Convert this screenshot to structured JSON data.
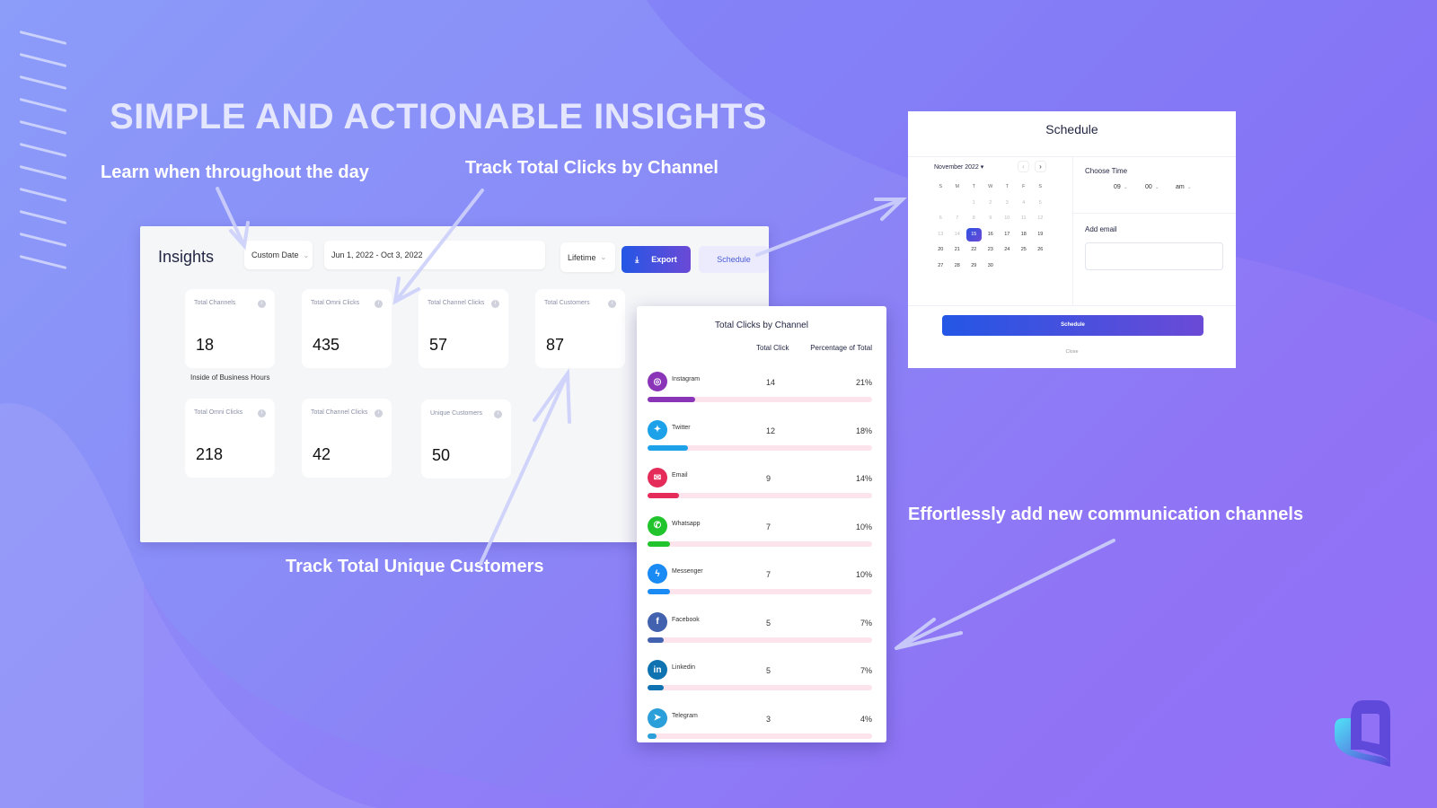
{
  "headline": "SIMPLE AND ACTIONABLE INSIGHTS",
  "captions": {
    "learn": "Learn when throughout the day",
    "clicks": "Track Total Clicks by Channel",
    "customers": "Track Total Unique Customers",
    "channels": "Effortlessly add new communication channels"
  },
  "insights": {
    "title": "Insights",
    "date_mode": "Custom Date",
    "date_range": "Jun 1, 2022 - Oct 3, 2022",
    "period": "Lifetime",
    "export_label": "Export",
    "schedule_label": "Schedule",
    "overview_cards": [
      {
        "label": "Total Channels",
        "value": "18"
      },
      {
        "label": "Total Omni Clicks",
        "value": "435"
      },
      {
        "label": "Total Channel Clicks",
        "value": "57"
      },
      {
        "label": "Total Customers",
        "value": "87"
      }
    ],
    "business_hours_label": "Inside of Business Hours",
    "business_cards": [
      {
        "label": "Total Omni Clicks",
        "value": "218"
      },
      {
        "label": "Total Channel Clicks",
        "value": "42"
      },
      {
        "label": "Unique Customers",
        "value": "50"
      }
    ]
  },
  "clicks_by_channel": {
    "title": "Total Clicks by Channel",
    "col_clicks": "Total Click",
    "col_pct": "Percentage of Total",
    "channels": [
      {
        "name": "Instagram",
        "clicks": "14",
        "pct": "21%",
        "fraction": 0.21,
        "color": "#8a35b8",
        "icon": "instagram-icon",
        "glyph": "◎"
      },
      {
        "name": "Twitter",
        "clicks": "12",
        "pct": "18%",
        "fraction": 0.18,
        "color": "#1da1e8",
        "icon": "twitter-icon",
        "glyph": "✦"
      },
      {
        "name": "Email",
        "clicks": "9",
        "pct": "14%",
        "fraction": 0.14,
        "color": "#e42b5a",
        "icon": "email-icon",
        "glyph": "✉"
      },
      {
        "name": "Whatsapp",
        "clicks": "7",
        "pct": "10%",
        "fraction": 0.1,
        "color": "#22c42e",
        "icon": "whatsapp-icon",
        "glyph": "✆"
      },
      {
        "name": "Messenger",
        "clicks": "7",
        "pct": "10%",
        "fraction": 0.1,
        "color": "#1a8af5",
        "icon": "messenger-icon",
        "glyph": "ϟ"
      },
      {
        "name": "Facebook",
        "clicks": "5",
        "pct": "7%",
        "fraction": 0.07,
        "color": "#4262b0",
        "icon": "facebook-icon",
        "glyph": "f"
      },
      {
        "name": "Linkedin",
        "clicks": "5",
        "pct": "7%",
        "fraction": 0.07,
        "color": "#0f72b1",
        "icon": "linkedin-icon",
        "glyph": "in"
      },
      {
        "name": "Telegram",
        "clicks": "3",
        "pct": "4%",
        "fraction": 0.04,
        "color": "#2b9fd9",
        "icon": "telegram-icon",
        "glyph": "➤"
      }
    ]
  },
  "schedule_modal": {
    "title": "Schedule",
    "month": "November 2022",
    "weekdays": [
      "S",
      "M",
      "T",
      "W",
      "T",
      "F",
      "S"
    ],
    "leading_blanks": 2,
    "days_in_month": 30,
    "selected_day": 15,
    "disabled_before": 15,
    "choose_time_label": "Choose Time",
    "hour": "09",
    "minute": "00",
    "ampm": "am",
    "add_email_label": "Add email",
    "email_value": "",
    "schedule_button": "Schedule",
    "close_label": "Close"
  }
}
